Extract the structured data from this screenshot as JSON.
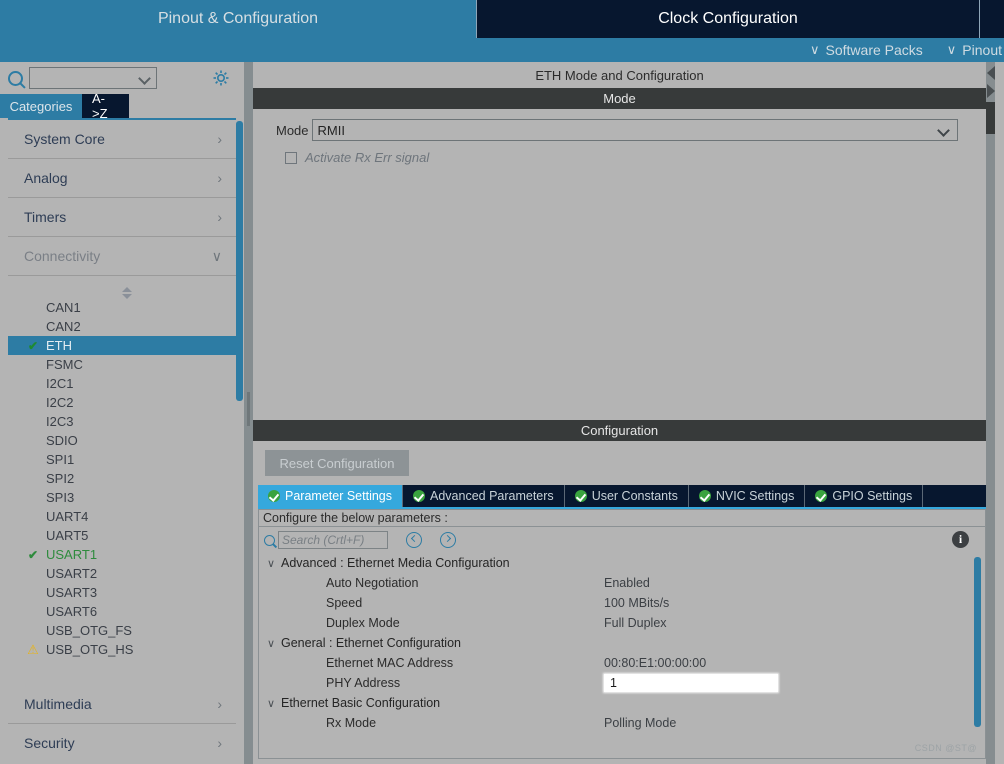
{
  "window": {
    "main_tabs": [
      {
        "label": "Pinout & Configuration",
        "active": true
      },
      {
        "label": "Clock Configuration",
        "active": false
      },
      {
        "label": "",
        "active": false
      }
    ],
    "sub_actions": [
      {
        "label": "Software Packs",
        "icon": "chevron-down-icon"
      },
      {
        "label": "Pinout",
        "icon": "chevron-down-icon"
      }
    ]
  },
  "sidebar": {
    "search_value": "",
    "search_icon": "search-icon",
    "settings_icon": "gear-icon",
    "tabs": [
      {
        "label": "Categories",
        "selected": true
      },
      {
        "label": "A->Z",
        "selected": false
      }
    ],
    "categories": [
      {
        "label": "System Core",
        "expanded": false,
        "icon": "chevron-right-icon"
      },
      {
        "label": "Analog",
        "expanded": false,
        "icon": "chevron-right-icon"
      },
      {
        "label": "Timers",
        "expanded": false,
        "icon": "chevron-right-icon"
      },
      {
        "label": "Connectivity",
        "expanded": true,
        "icon": "chevron-down-icon"
      }
    ],
    "peripherals": [
      {
        "label": "CAN1",
        "state": "none",
        "selected": false
      },
      {
        "label": "CAN2",
        "state": "none",
        "selected": false
      },
      {
        "label": "ETH",
        "state": "configured",
        "selected": true
      },
      {
        "label": "FSMC",
        "state": "none",
        "selected": false
      },
      {
        "label": "I2C1",
        "state": "none",
        "selected": false
      },
      {
        "label": "I2C2",
        "state": "none",
        "selected": false
      },
      {
        "label": "I2C3",
        "state": "none",
        "selected": false
      },
      {
        "label": "SDIO",
        "state": "none",
        "selected": false
      },
      {
        "label": "SPI1",
        "state": "none",
        "selected": false
      },
      {
        "label": "SPI2",
        "state": "none",
        "selected": false
      },
      {
        "label": "SPI3",
        "state": "none",
        "selected": false
      },
      {
        "label": "UART4",
        "state": "none",
        "selected": false
      },
      {
        "label": "UART5",
        "state": "none",
        "selected": false
      },
      {
        "label": "USART1",
        "state": "configured",
        "selected": false
      },
      {
        "label": "USART2",
        "state": "none",
        "selected": false
      },
      {
        "label": "USART3",
        "state": "none",
        "selected": false
      },
      {
        "label": "USART6",
        "state": "none",
        "selected": false
      },
      {
        "label": "USB_OTG_FS",
        "state": "none",
        "selected": false
      },
      {
        "label": "USB_OTG_HS",
        "state": "warning",
        "selected": false
      }
    ],
    "categories_bottom": [
      {
        "label": "Multimedia",
        "expanded": false,
        "icon": "chevron-right-icon"
      },
      {
        "label": "Security",
        "expanded": false,
        "icon": "chevron-right-icon"
      }
    ]
  },
  "main": {
    "panel_title": "ETH Mode and Configuration",
    "mode_section": {
      "header": "Mode",
      "mode_label": "Mode",
      "mode_value": "RMII",
      "checkbox": {
        "label": "Activate Rx Err signal",
        "checked": false
      }
    },
    "configuration_section": {
      "header": "Configuration",
      "reset_button": "Reset Configuration",
      "tabs": [
        {
          "label": "Parameter Settings",
          "active": true,
          "icon": "check-circle-icon"
        },
        {
          "label": "Advanced Parameters",
          "active": false,
          "icon": "check-circle-icon"
        },
        {
          "label": "User Constants",
          "active": false,
          "icon": "check-circle-icon"
        },
        {
          "label": "NVIC Settings",
          "active": false,
          "icon": "check-circle-icon"
        },
        {
          "label": "GPIO Settings",
          "active": false,
          "icon": "check-circle-icon"
        }
      ],
      "hint": "Configure the below parameters :",
      "search_placeholder": "Search (Crtl+F)",
      "search_value": "",
      "nav_prev_icon": "arrow-left-circle-icon",
      "nav_next_icon": "arrow-right-circle-icon",
      "info_icon": "info-icon",
      "groups": [
        {
          "label": "Advanced : Ethernet Media Configuration",
          "expanded": true,
          "rows": [
            {
              "name": "Auto Negotiation",
              "value": "Enabled",
              "editing": false
            },
            {
              "name": "Speed",
              "value": "100 MBits/s",
              "editing": false
            },
            {
              "name": "Duplex Mode",
              "value": "Full Duplex",
              "editing": false
            }
          ]
        },
        {
          "label": "General : Ethernet Configuration",
          "expanded": true,
          "rows": [
            {
              "name": "Ethernet MAC Address",
              "value": "00:80:E1:00:00:00",
              "editing": false
            },
            {
              "name": "PHY Address",
              "value": "1",
              "editing": true
            }
          ]
        },
        {
          "label": "Ethernet Basic Configuration",
          "expanded": true,
          "rows": [
            {
              "name": "Rx Mode",
              "value": "Polling Mode",
              "editing": false
            }
          ]
        }
      ]
    }
  },
  "watermark": "CSDN @ST@"
}
